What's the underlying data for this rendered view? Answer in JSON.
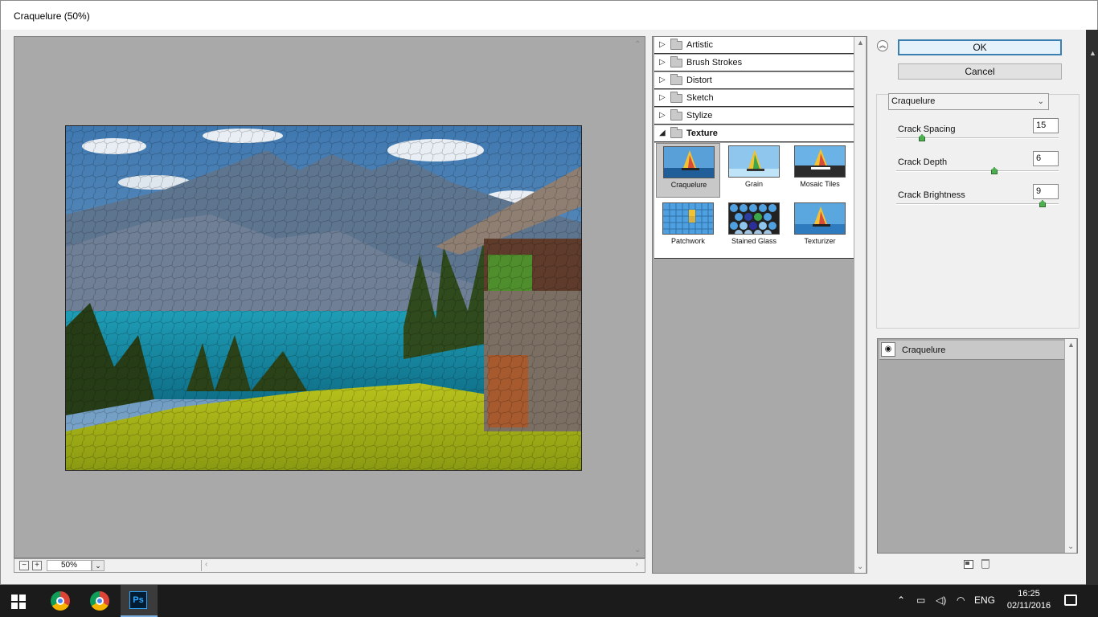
{
  "dialog": {
    "title": "Craquelure (50%)"
  },
  "preview": {
    "zoom": "50%"
  },
  "gallery": {
    "categories": [
      {
        "label": "Artistic",
        "expanded": false
      },
      {
        "label": "Brush Strokes",
        "expanded": false
      },
      {
        "label": "Distort",
        "expanded": false
      },
      {
        "label": "Sketch",
        "expanded": false
      },
      {
        "label": "Stylize",
        "expanded": false
      },
      {
        "label": "Texture",
        "expanded": true
      }
    ],
    "texture_filters": [
      {
        "label": "Craquelure",
        "selected": true
      },
      {
        "label": "Grain",
        "selected": false
      },
      {
        "label": "Mosaic Tiles",
        "selected": false
      },
      {
        "label": "Patchwork",
        "selected": false
      },
      {
        "label": "Stained Glass",
        "selected": false
      },
      {
        "label": "Texturizer",
        "selected": false
      }
    ]
  },
  "buttons": {
    "ok": "OK",
    "cancel": "Cancel"
  },
  "settings": {
    "filter_select": "Craquelure",
    "params": [
      {
        "label": "Crack Spacing",
        "value": "15",
        "slider_fraction": 0.15
      },
      {
        "label": "Crack Depth",
        "value": "6",
        "slider_fraction": 0.6
      },
      {
        "label": "Crack Brightness",
        "value": "9",
        "slider_fraction": 0.9
      }
    ]
  },
  "effect_layers": [
    {
      "label": "Craquelure",
      "visible": true
    }
  ],
  "taskbar": {
    "apps": [
      "Google Chrome",
      "Google Chrome",
      "Adobe Photoshop"
    ],
    "ps_label": "Ps",
    "language": "ENG",
    "time": "16:25",
    "date": "02/11/2016"
  },
  "colors": {
    "accent": "#3c7fb1",
    "panel": "#a9a9a9",
    "slider_knob": "#4caf50"
  }
}
